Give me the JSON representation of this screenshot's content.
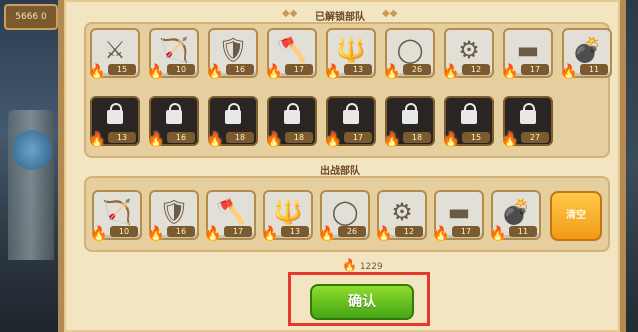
{
  "hud": {
    "label": "5666 0"
  },
  "unlocked_title": "已解锁部队",
  "battle_title": "出战部队",
  "unlocked_row1": [
    {
      "icon": "sword-icon",
      "glyph": "⚔",
      "level": "15"
    },
    {
      "icon": "crossbow-icon",
      "glyph": "🏹",
      "level": "10"
    },
    {
      "icon": "shield-icon",
      "glyph": "🛡",
      "level": "16"
    },
    {
      "icon": "axe-icon",
      "glyph": "🪓",
      "level": "17"
    },
    {
      "icon": "trident-icon",
      "glyph": "🔱",
      "level": "13"
    },
    {
      "icon": "ring-icon",
      "glyph": "◯",
      "level": "26"
    },
    {
      "icon": "claw-icon",
      "glyph": "⚙",
      "level": "12"
    },
    {
      "icon": "cannon-icon",
      "glyph": "▬",
      "level": "17"
    },
    {
      "icon": "bomb-icon",
      "glyph": "💣",
      "level": "11"
    }
  ],
  "unlocked_row2": [
    {
      "icon": "locked-icon",
      "level": "13"
    },
    {
      "icon": "locked-icon",
      "level": "16"
    },
    {
      "icon": "locked-icon",
      "level": "18"
    },
    {
      "icon": "locked-icon",
      "level": "18"
    },
    {
      "icon": "locked-icon",
      "level": "17"
    },
    {
      "icon": "locked-icon",
      "level": "18"
    },
    {
      "icon": "locked-icon",
      "level": "15"
    },
    {
      "icon": "locked-icon",
      "level": "27"
    }
  ],
  "battle_row": [
    {
      "icon": "crossbow-icon",
      "glyph": "🏹",
      "level": "10"
    },
    {
      "icon": "shield-icon",
      "glyph": "🛡",
      "level": "16"
    },
    {
      "icon": "axe-icon",
      "glyph": "🪓",
      "level": "17"
    },
    {
      "icon": "trident-icon",
      "glyph": "🔱",
      "level": "13"
    },
    {
      "icon": "ring-icon",
      "glyph": "◯",
      "level": "26"
    },
    {
      "icon": "claw-icon",
      "glyph": "⚙",
      "level": "12"
    },
    {
      "icon": "cannon-icon",
      "glyph": "▬",
      "level": "17"
    },
    {
      "icon": "bomb-icon",
      "glyph": "💣",
      "level": "11"
    }
  ],
  "clear_button": "清空",
  "total_power": "1229",
  "confirm_button": "确认",
  "colors": {
    "highlight": "#e53a2a",
    "confirm": "#45a614",
    "clear": "#f19a16"
  }
}
